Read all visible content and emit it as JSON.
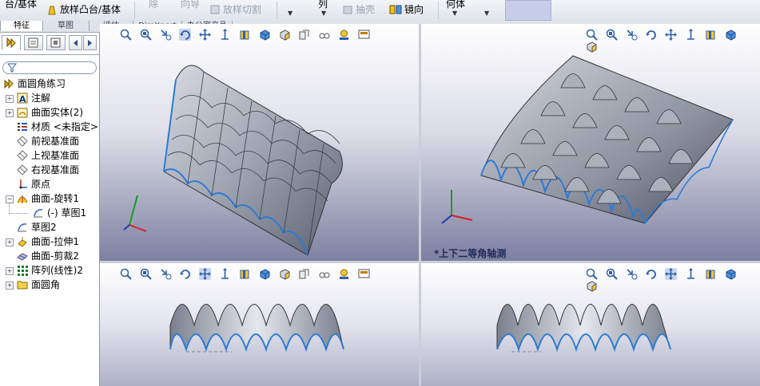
{
  "ribbon": {
    "item_boss_base": "台/基体",
    "item_loft_boss": "放样凸台/基体",
    "item_cut_partial": "除",
    "item_wizard_partial": "向导",
    "item_loft_cut": "放样切割",
    "item_pattern_partial": "列",
    "item_shell": "抽壳",
    "item_mirror": "镜向",
    "item_geometry_partial": "何体"
  },
  "tabs": [
    "特征",
    "草图",
    "评估",
    "DimXpert",
    "办公室产品"
  ],
  "tree": {
    "root": "面圆角练习",
    "items": [
      {
        "label": "注解",
        "expandable": true
      },
      {
        "label": "曲面实体(2)",
        "expandable": true
      },
      {
        "label": "材质 <未指定>",
        "expandable": false
      },
      {
        "label": "前视基准面",
        "expandable": false
      },
      {
        "label": "上视基准面",
        "expandable": false
      },
      {
        "label": "右视基准面",
        "expandable": false
      },
      {
        "label": "原点",
        "expandable": false
      },
      {
        "label": "曲面-旋转1",
        "expandable": true,
        "expanded": true
      },
      {
        "label": "(-) 草图1",
        "expandable": false,
        "child": true
      },
      {
        "label": "草图2",
        "expandable": false
      },
      {
        "label": "曲面-拉伸1",
        "expandable": true
      },
      {
        "label": "曲面-剪裁2",
        "expandable": false
      },
      {
        "label": "阵列(线性)2",
        "expandable": true
      },
      {
        "label": "面圆角",
        "expandable": true
      }
    ]
  },
  "viewports": {
    "top_right_label": "*上下二等角轴测"
  },
  "colors": {
    "accent": "#2c7bd6",
    "edge_blue": "#3aa0e0",
    "surface": "#9ea3b0"
  }
}
